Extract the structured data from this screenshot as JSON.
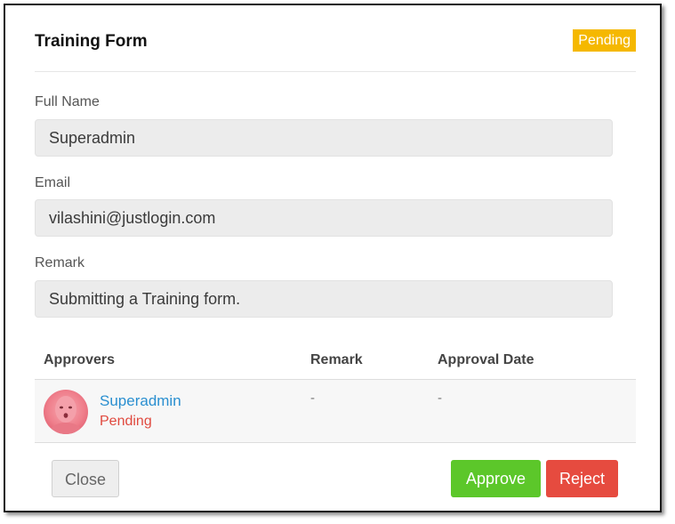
{
  "dialog": {
    "title": "Training Form",
    "status": "Pending",
    "status_color": "#f5b800"
  },
  "fields": {
    "full_name": {
      "label": "Full Name",
      "value": "Superadmin"
    },
    "email": {
      "label": "Email",
      "value": "vilashini@justlogin.com"
    },
    "remark": {
      "label": "Remark",
      "value": "Submitting a Training form."
    }
  },
  "approvals": {
    "headers": {
      "approvers": "Approvers",
      "remark": "Remark",
      "approval_date": "Approval Date"
    },
    "rows": [
      {
        "name": "Superadmin",
        "status": "Pending",
        "remark": "-",
        "approval_date": "-",
        "avatar_icon": "user-avatar-icon"
      }
    ]
  },
  "buttons": {
    "close": "Close",
    "approve": "Approve",
    "reject": "Reject"
  },
  "colors": {
    "approve": "#5cc72a",
    "reject": "#e64b3f",
    "link": "#2a8fd0",
    "pending_text": "#e04a3f"
  }
}
